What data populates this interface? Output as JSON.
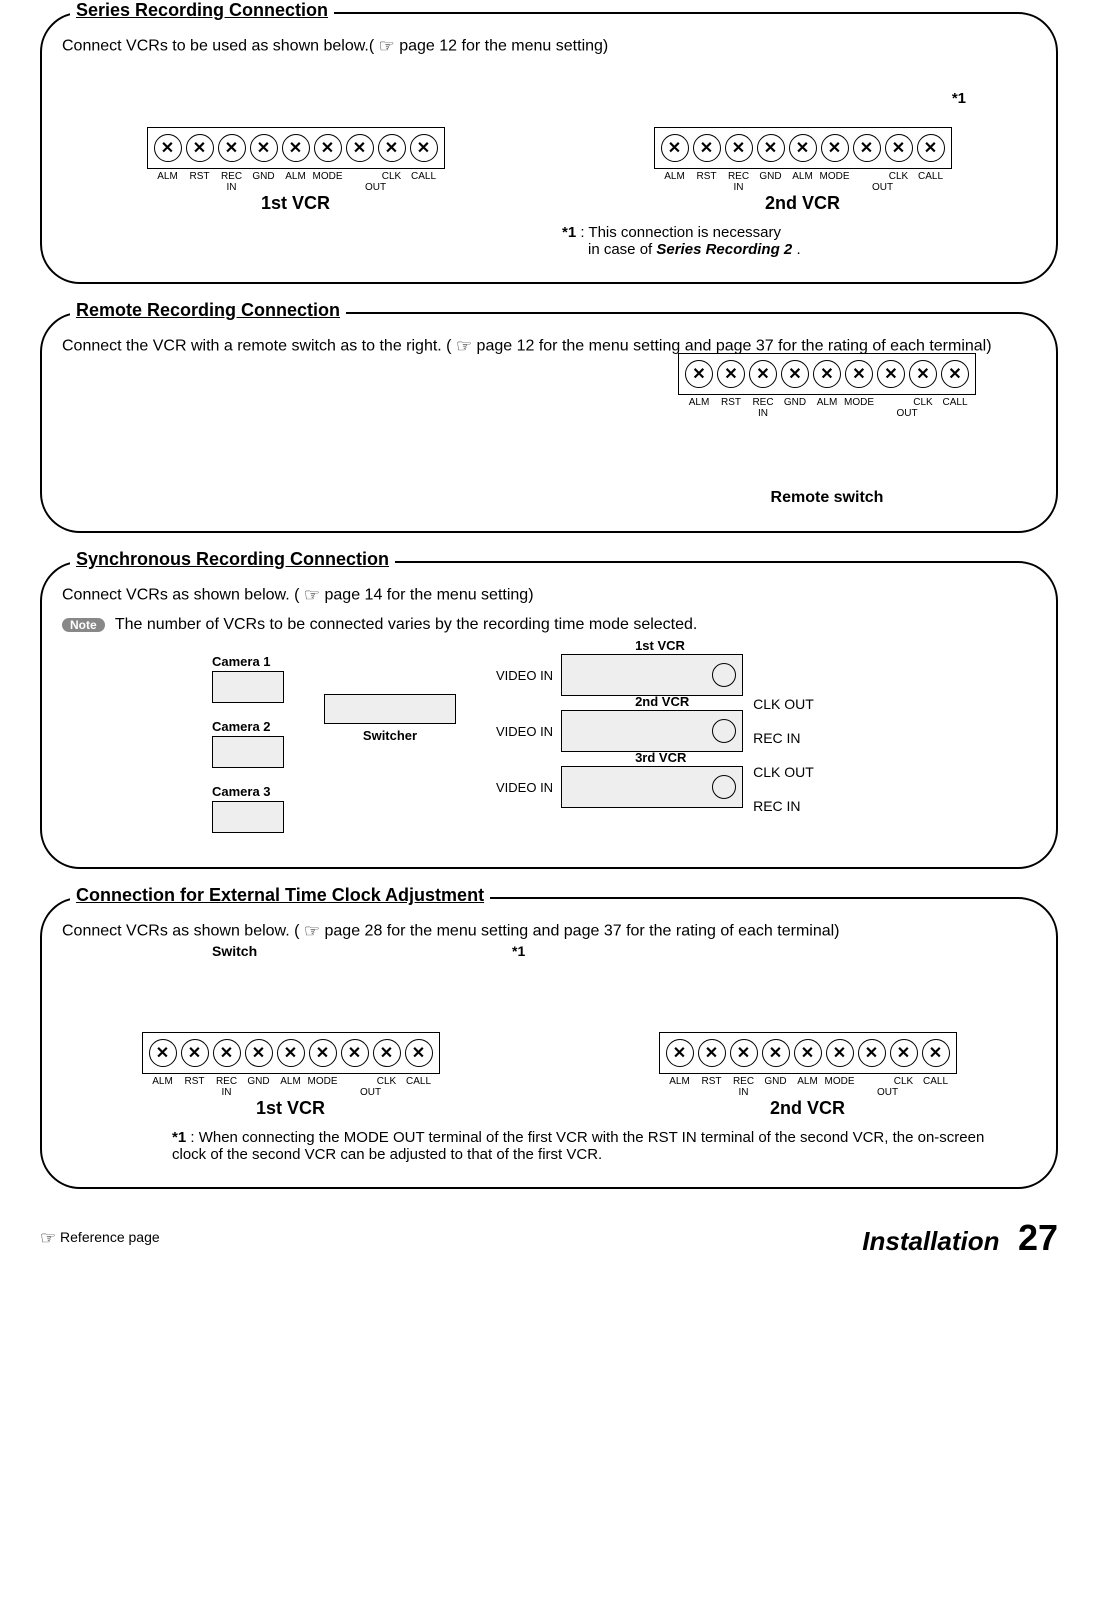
{
  "section1": {
    "title": "Series Recording Connection",
    "instruction_a": "Connect VCRs to be used as shown below.(",
    "instruction_b": " page 12 for the menu setting)",
    "vcr1_label": "1st VCR",
    "vcr2_label": "2nd VCR",
    "star_mark": "*1",
    "footnote_label": "*1",
    "footnote_a": " : This connection is necessary",
    "footnote_b": "in case of ",
    "footnote_c": "Series Recording 2",
    "footnote_d": "."
  },
  "terminal_labels": {
    "t1": "ALM",
    "t2": "RST",
    "t3": "REC",
    "t4": "GND",
    "t5": "ALM",
    "t6": "MODE",
    "t7": "",
    "t8": "CLK",
    "t9": "CALL",
    "in": "IN",
    "out": "OUT"
  },
  "section2": {
    "title": "Remote Recording Connection",
    "instruction_a": "Connect the VCR with a remote switch as to the right.  (",
    "instruction_b": " page 12 for the menu setting and page 37 for the rating of each terminal)",
    "remote_switch": "Remote switch"
  },
  "section3": {
    "title": "Synchronous Recording Connection",
    "instruction_a": "Connect VCRs as shown below. (",
    "instruction_b": " page 14 for the menu setting)",
    "note_badge": "Note",
    "note_text": " The number of VCRs to be connected varies by the recording time mode selected.",
    "camera1": "Camera 1",
    "camera2": "Camera 2",
    "camera3": "Camera 3",
    "switcher": "Switcher",
    "video_in": "VIDEO IN",
    "vcr1": "1st VCR",
    "vcr2": "2nd VCR",
    "vcr3": "3rd VCR",
    "clk_out": "CLK OUT",
    "rec_in": "REC IN"
  },
  "section4": {
    "title": "Connection for External Time Clock Adjustment",
    "instruction_a": "Connect VCRs as shown below. (",
    "instruction_b": " page 28 for the menu setting and page 37 for the rating of each terminal)",
    "switch_label": "Switch",
    "star_top": "*1",
    "vcr1_label": "1st VCR",
    "vcr2_label": "2nd VCR",
    "footnote_label": "*1",
    "footnote_text": " : When connecting the MODE OUT terminal of the first VCR with the RST IN terminal of the second VCR, the on-screen clock of the second VCR can be adjusted to that of the first VCR."
  },
  "footer": {
    "ref_page": " Reference page",
    "installation": "Installation",
    "page_number": "27"
  }
}
